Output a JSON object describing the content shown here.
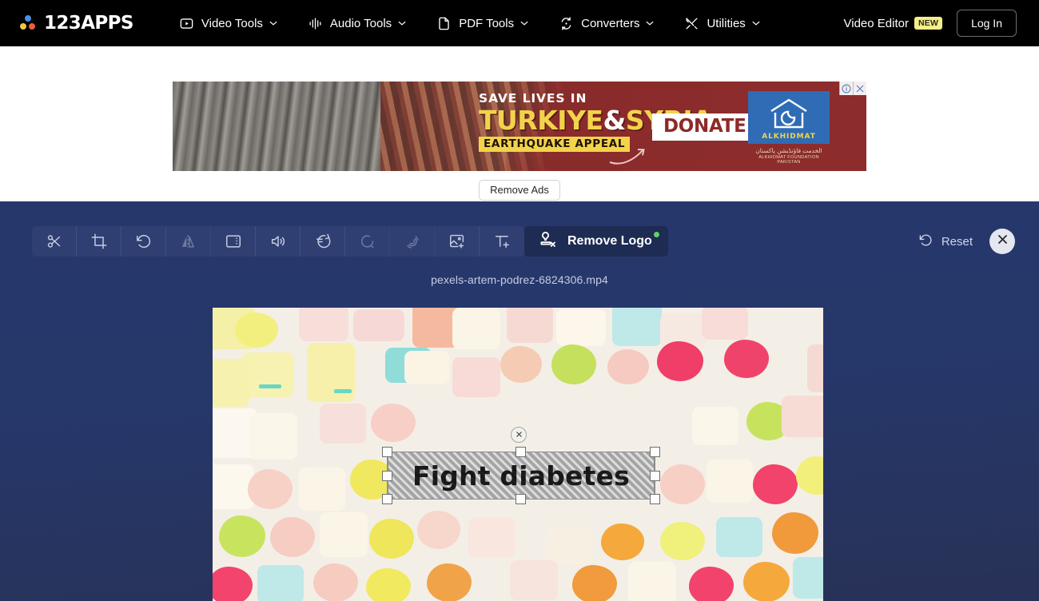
{
  "header": {
    "logo": {
      "text": "123APPS",
      "icon": "logo-dots-icon"
    },
    "nav": [
      {
        "label": "Video Tools",
        "icon": "play-square-icon",
        "caret": "chevron-down-icon"
      },
      {
        "label": "Audio Tools",
        "icon": "waveform-icon",
        "caret": "chevron-down-icon"
      },
      {
        "label": "PDF Tools",
        "icon": "document-icon",
        "caret": "chevron-down-icon"
      },
      {
        "label": "Converters",
        "icon": "convert-arrows-icon",
        "caret": "chevron-down-icon"
      },
      {
        "label": "Utilities",
        "icon": "tools-cross-icon",
        "caret": "chevron-down-icon"
      }
    ],
    "video_editor_label": "Video Editor",
    "video_editor_badge": "NEW",
    "login_label": "Log In"
  },
  "ad": {
    "line1": "SAVE LIVES IN",
    "title_part1": "TURKIYE",
    "title_amp": "&",
    "title_part2": "SYRIA",
    "subtitle": "EARTHQUAKE APPEAL",
    "cta": "DONATE NOW",
    "sponsor_name": "ALKHIDMAT",
    "sponsor_arabic": "الخدمت فاؤنڈیشن پاکستان",
    "sponsor_sub": "ALKHIDMAT FOUNDATION PAKISTAN",
    "info_icon": "adchoices-info-icon",
    "close_icon": "close-x-icon",
    "remove_ads_label": "Remove Ads"
  },
  "editor": {
    "filename": "pexels-artem-podrez-6824306.mp4",
    "tools": [
      {
        "name": "cut-scissors-icon",
        "label": "Cut",
        "dim": false
      },
      {
        "name": "crop-icon",
        "label": "Crop",
        "dim": false
      },
      {
        "name": "rotate-ccw-icon",
        "label": "Rotate",
        "dim": false
      },
      {
        "name": "flip-icon",
        "label": "Flip",
        "dim": true
      },
      {
        "name": "resize-frame-icon",
        "label": "Resize",
        "dim": false
      },
      {
        "name": "volume-icon",
        "label": "Volume",
        "dim": false
      },
      {
        "name": "speed-icon",
        "label": "Speed",
        "dim": false
      },
      {
        "name": "loop-icon",
        "label": "Loop",
        "dim": true
      },
      {
        "name": "stabilize-hand-icon",
        "label": "Stabilize",
        "dim": true
      },
      {
        "name": "add-image-icon",
        "label": "Add Image",
        "dim": false
      },
      {
        "name": "add-text-icon",
        "label": "Add Text",
        "dim": false
      }
    ],
    "remove_logo": {
      "label": "Remove Logo",
      "icon": "stamp-remove-icon",
      "badge": "new-dot"
    },
    "reset_label": "Reset",
    "reset_icon": "rotate-ccw-icon",
    "close_icon": "close-x-icon",
    "overlay": {
      "text": "Fight diabetes",
      "close_icon": "close-x-icon",
      "handles": [
        "top-left",
        "top-center",
        "top-right",
        "middle-left",
        "middle-right",
        "bottom-left",
        "bottom-center",
        "bottom-right"
      ]
    }
  },
  "colors": {
    "header_bg": "#000000",
    "editor_bg": "#26376c",
    "editor_bg_bottom": "#283257",
    "remove_logo_bg": "#1e2b52",
    "badge_new": "#f5ed8a",
    "ad_red": "#8a2b2b",
    "ad_yellow": "#f2d34a",
    "green_dot": "#5fd16a"
  }
}
